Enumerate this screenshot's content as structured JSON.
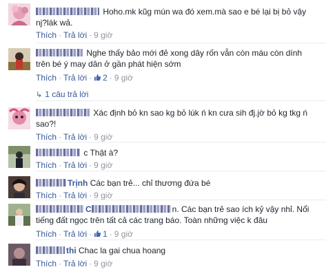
{
  "actions": {
    "like": "Thích",
    "reply": "Trả lời",
    "sep": "·"
  },
  "comments": [
    {
      "name": "",
      "text": "Hoho.mk kũg mún wa đó xem.mà sao e bé lại bị bỏ vậy nj?lák wả.",
      "time": "9 giờ"
    },
    {
      "name": "",
      "text": "Nghe thấy bảo mới đẻ xong dây rốn vẫn còn máu còn dính trên bé ý may dân ở gần phát hiện sớm",
      "likes": "2",
      "time": "9 giờ",
      "replies": "1 câu trả lời"
    },
    {
      "name": "",
      "text": "Xác định bỏ kn sao kg bỏ lúk ń kn cưa sih đj.jờ bỏ kg tkg ń sao?!",
      "time": "9 giờ"
    },
    {
      "name": "",
      "text": "c Thật à?",
      "time": "9 giờ"
    },
    {
      "name": "Trịnh",
      "text": "Các bạn trẻ... chỉ thương đứa bé",
      "time": "9 giờ"
    },
    {
      "name": "",
      "text": "n. Các bạn trẻ sao ích kỷ vậy nhỉ. Nổi tiếng đất ngọc trên tất cả các trang báo. Toàn những việc k đâu",
      "likes": "1",
      "time": "9 giờ"
    },
    {
      "name": "thi",
      "text": "Chac la gai chua hoang",
      "time": "9 giờ"
    }
  ],
  "colors": {
    "link": "#365899",
    "meta": "#90949c",
    "text": "#1d2129"
  }
}
